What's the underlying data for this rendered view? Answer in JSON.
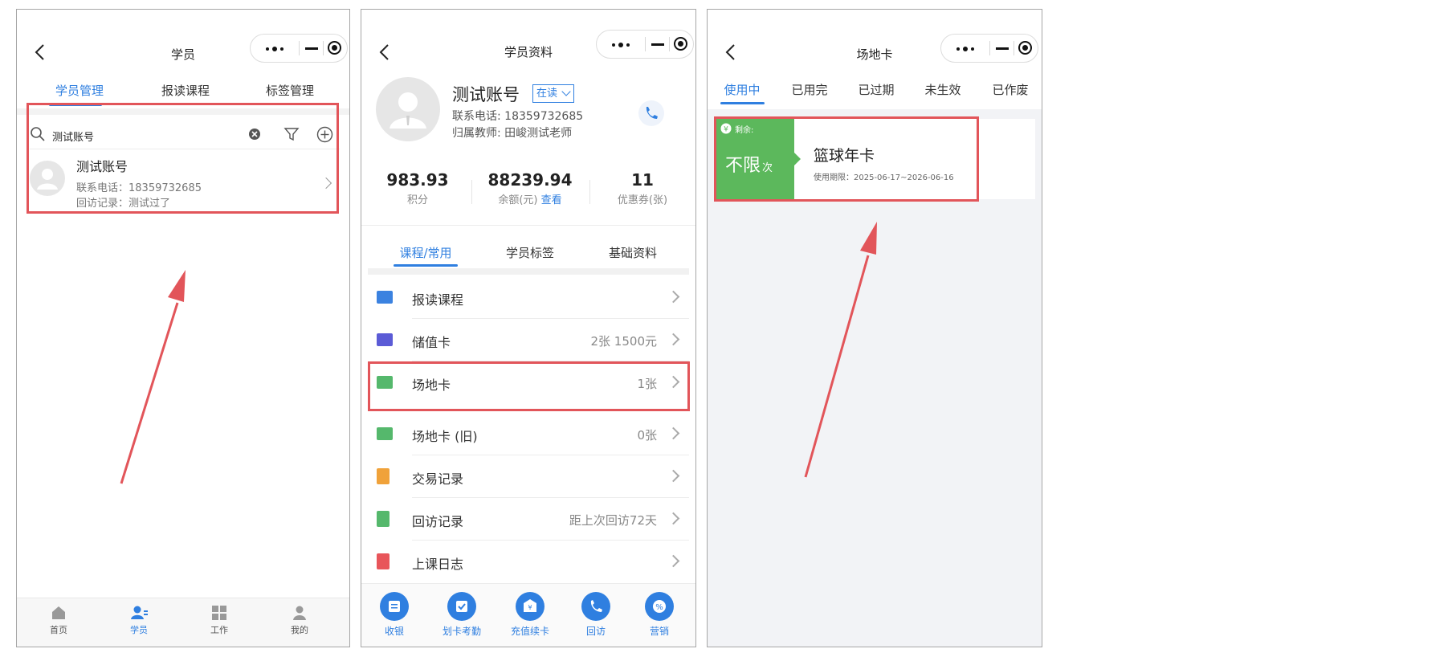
{
  "left": {
    "title": "学员",
    "tabs": [
      "学员管理",
      "报读课程",
      "标签管理"
    ],
    "search_value": "测试账号",
    "student": {
      "name": "测试账号",
      "phone": "联系电话：18359732685",
      "visit": "回访记录：测试过了"
    },
    "bottom_nav": [
      "首页",
      "学员",
      "工作",
      "我的"
    ]
  },
  "middle": {
    "title": "学员资料",
    "profile": {
      "name": "测试账号",
      "status": "在读",
      "phone": "联系电话: 18359732685",
      "teacher": "归属教师: 田峻测试老师"
    },
    "stats": {
      "points": "983.93",
      "points_label": "积分",
      "balance": "88239.94",
      "balance_label": "余额(元)",
      "balance_link": "查看",
      "coupons": "11",
      "coupons_label": "优惠券(张)"
    },
    "tabs": [
      "课程/常用",
      "学员标签",
      "基础资料"
    ],
    "rows": [
      {
        "label": "报读课程",
        "value": ""
      },
      {
        "label": "储值卡",
        "value": "2张 1500元"
      },
      {
        "label": "场地卡",
        "value": "1张"
      },
      {
        "label": "场地卡 (旧)",
        "value": "0张"
      },
      {
        "label": "交易记录",
        "value": ""
      },
      {
        "label": "回访记录",
        "value": "距上次回访72天"
      },
      {
        "label": "上课日志",
        "value": ""
      }
    ],
    "actions": [
      "收银",
      "划卡考勤",
      "充值续卡",
      "回访",
      "营销"
    ]
  },
  "right": {
    "title": "场地卡",
    "tabs": [
      "使用中",
      "已用完",
      "已过期",
      "未生效",
      "已作废"
    ],
    "card": {
      "remaining_label": "剩余:",
      "remaining_value": "不限",
      "unit": "次",
      "name": "篮球年卡",
      "validity": "使用期限：2025-06-17~2026-06-16"
    }
  },
  "colors": {
    "accent": "#2f7fe0",
    "highlight": "#e2555a",
    "green": "#5cb85c"
  }
}
